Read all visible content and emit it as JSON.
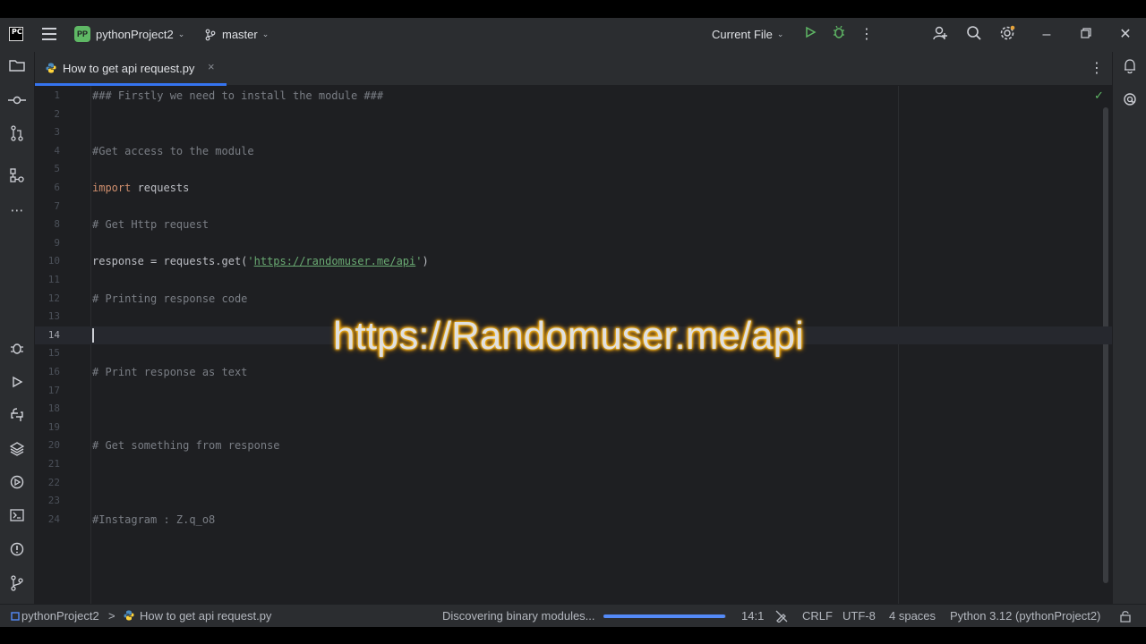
{
  "titlebar": {
    "logo_text": "PC",
    "project_badge": "PP",
    "project_name": "pythonProject2",
    "branch": "master",
    "run_config": "Current File",
    "icons": [
      "hamburger-menu-icon",
      "branch-icon",
      "run-icon",
      "debug-icon",
      "more-vertical-icon",
      "add-user-icon",
      "search-icon",
      "settings-icon",
      "minimize-icon",
      "restore-icon",
      "close-icon"
    ]
  },
  "left_toolbar": {
    "icons": [
      "project-folder-icon",
      "commit-icon",
      "pull-requests-icon",
      "structure-icon",
      "more-icon",
      "debug-icon",
      "run-icon",
      "python-console-icon",
      "layers-icon",
      "services-icon",
      "terminal-icon",
      "problems-icon",
      "git-icon"
    ]
  },
  "right_toolbar": {
    "icons": [
      "notifications-icon",
      "ai-assistant-icon"
    ]
  },
  "tab": {
    "label": "How to get api request.py",
    "close_glyph": "×"
  },
  "editor": {
    "current_line": 14,
    "lines": [
      {
        "n": "1",
        "parts": [
          {
            "t": "### Firstly we need to install the module ###",
            "c": "cm"
          }
        ]
      },
      {
        "n": "2",
        "parts": []
      },
      {
        "n": "3",
        "parts": []
      },
      {
        "n": "4",
        "parts": [
          {
            "t": "#Get access to the module",
            "c": "cm"
          }
        ]
      },
      {
        "n": "5",
        "parts": []
      },
      {
        "n": "6",
        "parts": [
          {
            "t": "import",
            "c": "kw"
          },
          {
            "t": " requests",
            "c": "id"
          }
        ]
      },
      {
        "n": "7",
        "parts": []
      },
      {
        "n": "8",
        "parts": [
          {
            "t": "# Get Http request",
            "c": "cm"
          }
        ]
      },
      {
        "n": "9",
        "parts": []
      },
      {
        "n": "10",
        "parts": [
          {
            "t": "response = requests.get(",
            "c": "id"
          },
          {
            "t": "'",
            "c": "str"
          },
          {
            "t": "https://randomuser.me/api",
            "c": "url"
          },
          {
            "t": "'",
            "c": "str"
          },
          {
            "t": ")",
            "c": "id"
          }
        ]
      },
      {
        "n": "11",
        "parts": []
      },
      {
        "n": "12",
        "parts": [
          {
            "t": "# Printing response code",
            "c": "cm"
          }
        ]
      },
      {
        "n": "13",
        "parts": []
      },
      {
        "n": "14",
        "parts": []
      },
      {
        "n": "15",
        "parts": []
      },
      {
        "n": "16",
        "parts": [
          {
            "t": "# Print response as text",
            "c": "cm"
          }
        ]
      },
      {
        "n": "17",
        "parts": []
      },
      {
        "n": "18",
        "parts": []
      },
      {
        "n": "19",
        "parts": []
      },
      {
        "n": "20",
        "parts": [
          {
            "t": "# Get something from response",
            "c": "cm"
          }
        ]
      },
      {
        "n": "21",
        "parts": []
      },
      {
        "n": "22",
        "parts": []
      },
      {
        "n": "23",
        "parts": []
      },
      {
        "n": "24",
        "parts": [
          {
            "t": "#Instagram : Z.q_o8",
            "c": "cm"
          }
        ]
      }
    ]
  },
  "overlay": {
    "text": "https://Randomuser.me/api"
  },
  "statusbar": {
    "project": "pythonProject2",
    "separator": ">",
    "file": "How to get api request.py",
    "task": "Discovering binary modules...",
    "progress_fraction": 0.99,
    "position": "14:1",
    "line_separator": "CRLF",
    "encoding": "UTF-8",
    "indent": "4 spaces",
    "interpreter": "Python 3.12 (pythonProject2)"
  },
  "colors": {
    "accent": "#3574f0",
    "keyword": "#cf8e6d",
    "comment": "#7a7e85",
    "string": "#6aab73",
    "overlay_glow": "#ffa800"
  }
}
